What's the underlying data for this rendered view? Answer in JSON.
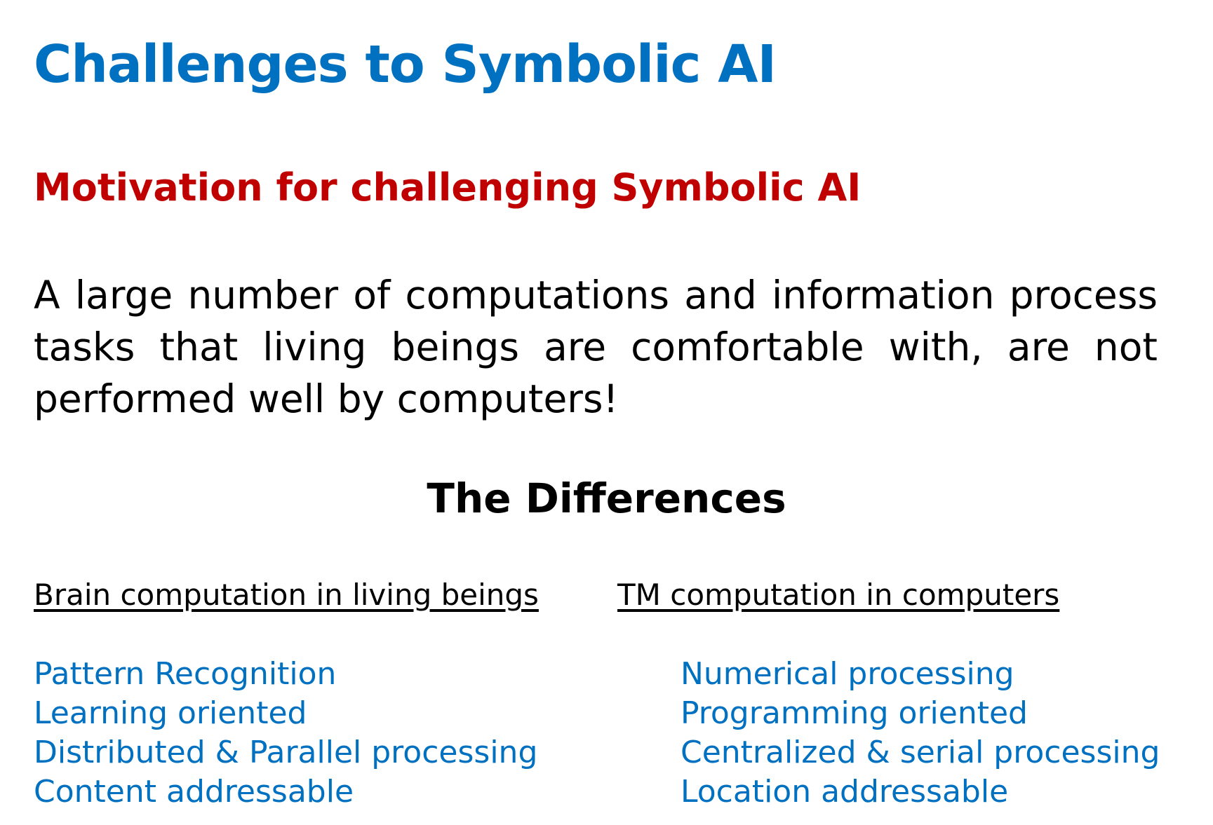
{
  "slide": {
    "title": "Challenges to Symbolic AI",
    "subtitle": "Motivation for challenging Symbolic AI",
    "body": "A large number of computations and information process tasks that living beings are comfortable with, are not performed well by computers!",
    "differences_heading": "The Differences",
    "columns": {
      "left": {
        "heading": "Brain computation in living beings",
        "items": [
          "Pattern Recognition",
          "Learning oriented",
          "Distributed & Parallel processing",
          "Content addressable"
        ]
      },
      "right": {
        "heading": "TM computation in computers",
        "items": [
          "Numerical processing",
          "Programming oriented",
          "Centralized & serial processing",
          "Location addressable"
        ]
      }
    }
  },
  "colors": {
    "title": "#0070c0",
    "subtitle": "#c00000",
    "list_text": "#0070c0",
    "body_text": "#000000"
  }
}
